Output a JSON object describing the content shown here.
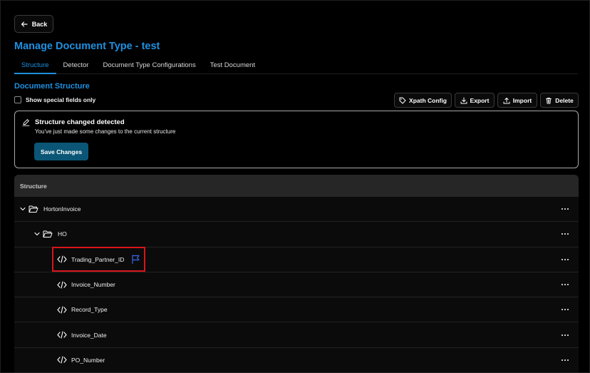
{
  "back_label": "Back",
  "page_title": "Manage Document Type - test",
  "tabs": [
    {
      "label": "Structure",
      "active": true
    },
    {
      "label": "Detector",
      "active": false
    },
    {
      "label": "Document Type Configurations",
      "active": false
    },
    {
      "label": "Test Document",
      "active": false
    }
  ],
  "section_title": "Document Structure",
  "special_fields": {
    "label": "Show special fields only",
    "checked": false
  },
  "toolbar": {
    "xpath_label": "Xpath Config",
    "export_label": "Export",
    "import_label": "Import",
    "delete_label": "Delete"
  },
  "notice": {
    "title": "Structure changed detected",
    "text": "You've just made some changes to the current structure",
    "save_label": "Save Changes"
  },
  "structure": {
    "header": "Structure",
    "rows": [
      {
        "label": "HortonInvoice",
        "type": "folder",
        "level": 0,
        "expanded": true
      },
      {
        "label": "HO",
        "type": "folder",
        "level": 1,
        "expanded": true
      },
      {
        "label": "Trading_Partner_ID",
        "type": "field",
        "level": 2,
        "flagged": true,
        "highlighted": true
      },
      {
        "label": "Invoice_Number",
        "type": "field",
        "level": 2
      },
      {
        "label": "Record_Type",
        "type": "field",
        "level": 2
      },
      {
        "label": "Invoice_Date",
        "type": "field",
        "level": 2
      },
      {
        "label": "PO_Number",
        "type": "field",
        "level": 2
      }
    ]
  },
  "colors": {
    "accent": "#1e90e0",
    "save_button": "#0b5676",
    "flag": "#3a66e8",
    "highlight_box": "#d8151b"
  }
}
